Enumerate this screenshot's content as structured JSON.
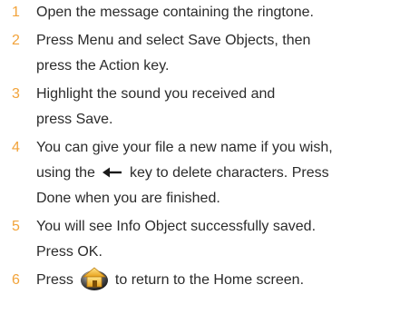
{
  "steps": [
    {
      "number": "1",
      "lines": [
        "Open the message containing the ringtone."
      ]
    },
    {
      "number": "2",
      "lines": [
        "Press Menu and select Save Objects, then",
        "press the Action key."
      ]
    },
    {
      "number": "3",
      "lines": [
        "Highlight the sound you received and",
        "press Save."
      ]
    },
    {
      "number": "4",
      "line1": "You can give your file a new name if you wish,",
      "line2_before_icon": "using the",
      "line2_after_icon": "key to delete characters. Press",
      "line3": "Done when you are finished.",
      "icon": "left-arrow-icon"
    },
    {
      "number": "5",
      "lines": [
        "You will see Info Object successfully saved.",
        "Press OK."
      ]
    },
    {
      "number": "6",
      "before_icon": "Press",
      "after_icon": "to return to the Home screen.",
      "icon": "home-key-icon"
    }
  ],
  "colors": {
    "number": "#f2a33a",
    "text": "#2b2b2b"
  }
}
